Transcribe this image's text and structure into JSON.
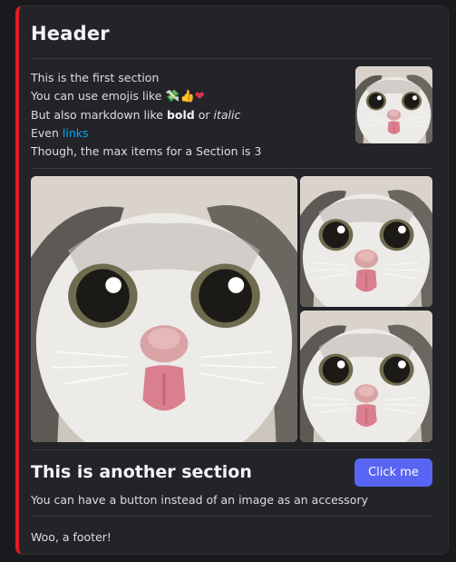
{
  "header": {
    "title": "Header"
  },
  "section1": {
    "line1": "This is the first section",
    "line2_prefix": "You can use emojis like",
    "emojis": [
      "money-with-wings-emoji",
      "thumbs-up-emoji",
      "red-heart-emoji"
    ],
    "line3_prefix": "But also markdown like",
    "bold_word": "bold",
    "or_word": "or",
    "italic_word": "italic",
    "line4_prefix": "Even",
    "link_text": "links",
    "line5": "Though, the max items for a Section is 3"
  },
  "gallery": {
    "images": [
      "cat-tongue-photo",
      "cat-tongue-photo",
      "cat-tongue-photo"
    ]
  },
  "section2": {
    "title": "This is another section",
    "description": "You can have a button instead of an image as an accessory",
    "button_label": "Click me"
  },
  "footer": {
    "text": "Woo, a footer!"
  },
  "colors": {
    "accent_bar": "#e01b24",
    "button": "#5865f2",
    "link": "#00a8fc",
    "background": "#232428"
  }
}
